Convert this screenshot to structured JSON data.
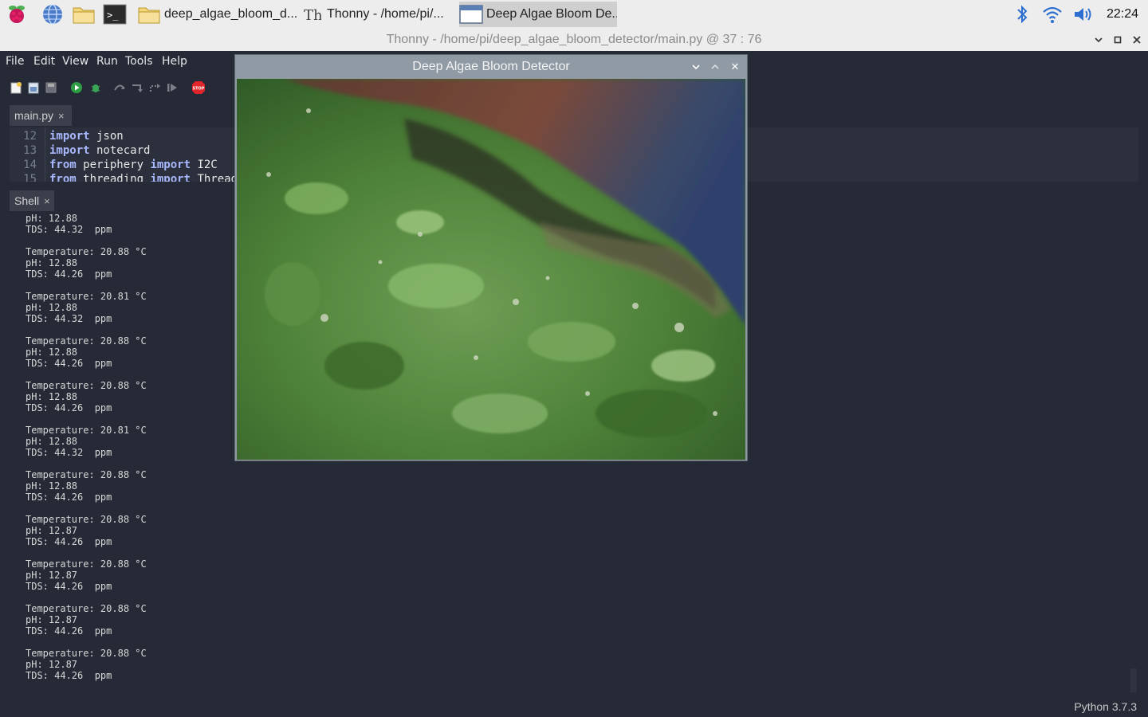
{
  "taskbar": {
    "tasks": [
      {
        "label": "deep_algae_bloom_d...",
        "icon": "folder-icon"
      },
      {
        "label": "Thonny  -  /home/pi/...",
        "icon": "thonny-icon"
      },
      {
        "label": "Deep Algae Bloom De...",
        "icon": "window-icon"
      }
    ],
    "clock": "22:24"
  },
  "thonny": {
    "title": "Thonny  -  /home/pi/deep_algae_bloom_detector/main.py  @  37 : 76",
    "menu": [
      "File",
      "Edit",
      "View",
      "Run",
      "Tools",
      "Help"
    ],
    "editor_tab": "main.py",
    "close_glyph": "×",
    "editor_lines": [
      {
        "num": "12",
        "kw": "import",
        "rest": " json"
      },
      {
        "num": "13",
        "kw": "import",
        "rest": " notecard"
      },
      {
        "num": "14",
        "kw": "from",
        "rest": " periphery ",
        "kw2": "import",
        "rest2": " I2C"
      },
      {
        "num": "15",
        "kw": "from",
        "rest": " threading ",
        "kw2": "import",
        "rest2": " Thread"
      }
    ],
    "shell_tab": "Shell",
    "shell_first": [
      "pH: 12.88",
      "TDS: 44.32  ppm"
    ],
    "shell_blocks": [
      [
        "Temperature: 20.88 °C",
        "pH: 12.88",
        "TDS: 44.26  ppm"
      ],
      [
        "Temperature: 20.81 °C",
        "pH: 12.88",
        "TDS: 44.32  ppm"
      ],
      [
        "Temperature: 20.88 °C",
        "pH: 12.88",
        "TDS: 44.26  ppm"
      ],
      [
        "Temperature: 20.88 °C",
        "pH: 12.88",
        "TDS: 44.26  ppm"
      ],
      [
        "Temperature: 20.81 °C",
        "pH: 12.88",
        "TDS: 44.32  ppm"
      ],
      [
        "Temperature: 20.88 °C",
        "pH: 12.88",
        "TDS: 44.26  ppm"
      ],
      [
        "Temperature: 20.88 °C",
        "pH: 12.87",
        "TDS: 44.26  ppm"
      ],
      [
        "Temperature: 20.88 °C",
        "pH: 12.87",
        "TDS: 44.26  ppm"
      ],
      [
        "Temperature: 20.88 °C",
        "pH: 12.87",
        "TDS: 44.26  ppm"
      ],
      [
        "Temperature: 20.88 °C",
        "pH: 12.87",
        "TDS: 44.26  ppm"
      ]
    ],
    "python_version": "Python 3.7.3"
  },
  "camera_window": {
    "title": "Deep Algae Bloom Detector",
    "close_glyph": "✕"
  },
  "colors": {
    "panel": "#ededed",
    "editor_bg": "#262a37",
    "keyword": "#a9b9ff",
    "stop_red": "#e0262a"
  }
}
